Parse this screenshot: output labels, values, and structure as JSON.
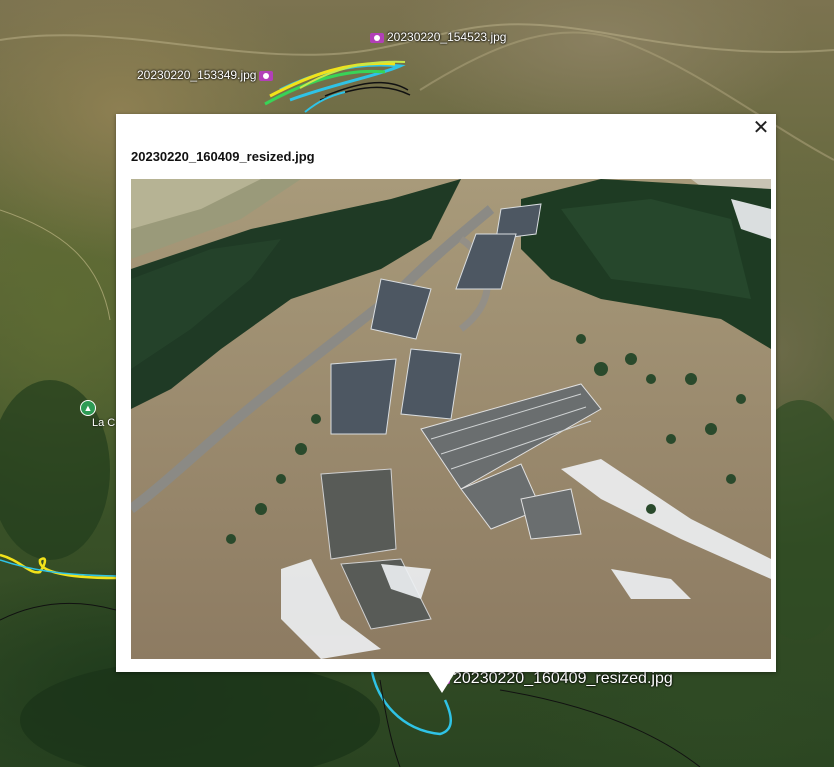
{
  "map": {
    "photo_markers": [
      {
        "name": "20230220_154523.jpg",
        "icon": "camera-icon"
      },
      {
        "name": "20230220_153349.jpg",
        "icon": "camera-icon"
      },
      {
        "name": "20230220_160409_resized.jpg",
        "icon": "camera-icon"
      }
    ],
    "place": {
      "label": "La C",
      "icon": "hiking-icon"
    },
    "track_colors": {
      "yellow": "#f2e21a",
      "cyan": "#2fc3e6",
      "green": "#39d357",
      "black": "#111111"
    }
  },
  "balloon": {
    "title": "20230220_160409_resized.jpg",
    "close_symbol": "✕",
    "close_icon": "close-icon",
    "photo_alt": "Aerial drone photograph of a mountain ski resort village with buildings, a winding road, conifer forest and patches of snow"
  }
}
